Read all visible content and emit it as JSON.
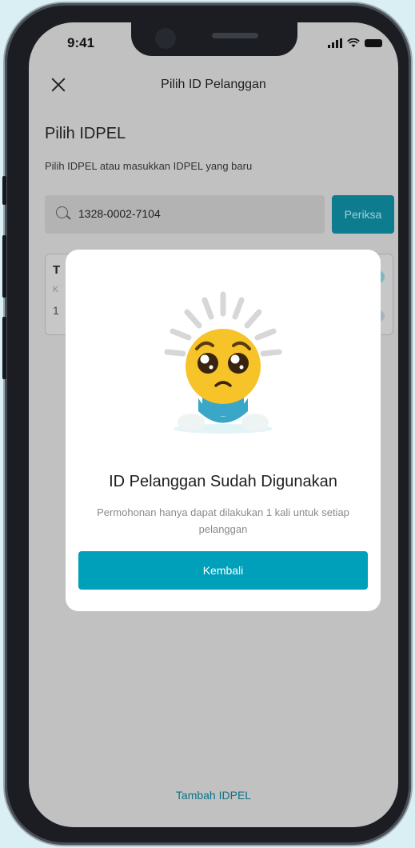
{
  "status_bar": {
    "time": "9:41"
  },
  "header": {
    "title": "Pilih ID Pelanggan"
  },
  "page": {
    "title": "Pilih IDPEL",
    "subtitle": "Pilih IDPEL atau masukkan IDPEL yang baru"
  },
  "search": {
    "value": "1328-0002-7104",
    "button_label": "Periksa"
  },
  "background_card": {
    "title_fragment": "T",
    "sub_fragment": "K",
    "number_fragment": "1"
  },
  "footer": {
    "add_label": "Tambah IDPEL"
  },
  "modal": {
    "title": "ID Pelanggan Sudah Digunakan",
    "description": "Permohonan hanya dapat dilakukan 1 kali untuk setiap pelanggan",
    "button_label": "Kembali",
    "illustration_icon": "sad-lightbulb-icon"
  },
  "colors": {
    "accent": "#00a0ba",
    "accent_dimmed": "#0e7c8f",
    "link": "#0a7388",
    "overlay": "#c1c1c1",
    "background": "#d9eff3"
  }
}
